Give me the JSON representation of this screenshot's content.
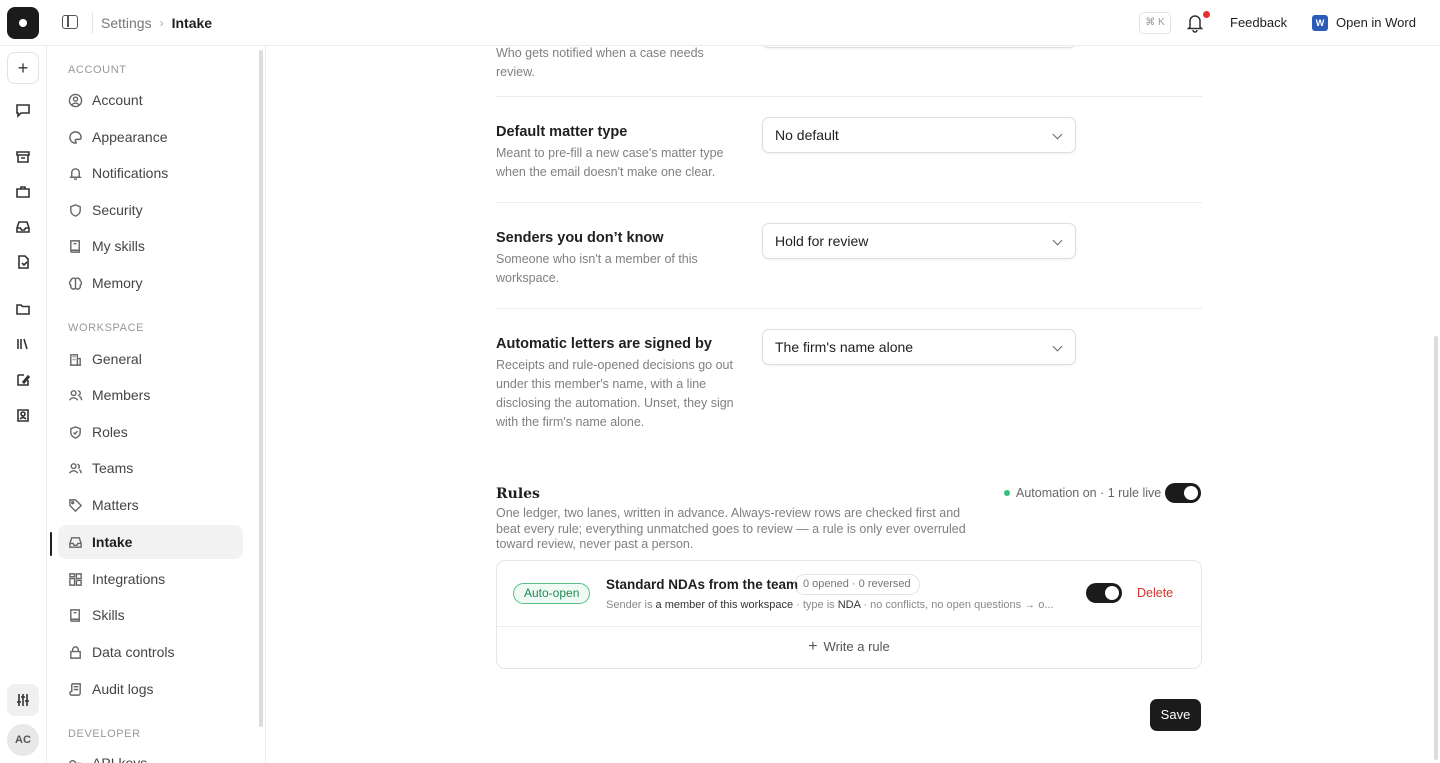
{
  "topbar": {
    "breadcrumb_root": "Settings",
    "breadcrumb_separator": "›",
    "breadcrumb_current": "Intake",
    "shortcut": "⌘ K",
    "feedback": "Feedback",
    "open_in_word": "Open in Word",
    "word_icon_letter": "W",
    "notification_dot_color": "#e5302e"
  },
  "rail": {
    "avatar_initials": "AC",
    "icons": [
      "new-icon",
      "chat-icon",
      "archive-icon",
      "briefcase-icon",
      "inbox-icon",
      "document-icon",
      "folder-icon",
      "library-icon",
      "edit-icon",
      "contact-icon",
      "sliders-icon"
    ]
  },
  "nav": {
    "account_title": "ACCOUNT",
    "account_items": [
      {
        "label": "Account",
        "icon": "user-circle-icon"
      },
      {
        "label": "Appearance",
        "icon": "palette-icon"
      },
      {
        "label": "Notifications",
        "icon": "bell-icon"
      },
      {
        "label": "Security",
        "icon": "shield-icon"
      },
      {
        "label": "My skills",
        "icon": "book-icon"
      },
      {
        "label": "Memory",
        "icon": "brain-icon"
      }
    ],
    "workspace_title": "WORKSPACE",
    "workspace_items": [
      {
        "label": "General",
        "icon": "building-icon"
      },
      {
        "label": "Members",
        "icon": "users-icon"
      },
      {
        "label": "Roles",
        "icon": "shield-check-icon"
      },
      {
        "label": "Teams",
        "icon": "team-icon"
      },
      {
        "label": "Matters",
        "icon": "tag-icon"
      },
      {
        "label": "Intake",
        "icon": "inbox-icon",
        "active": true
      },
      {
        "label": "Integrations",
        "icon": "blocks-icon"
      },
      {
        "label": "Skills",
        "icon": "book-icon"
      },
      {
        "label": "Data controls",
        "icon": "lock-icon"
      },
      {
        "label": "Audit logs",
        "icon": "scroll-icon"
      }
    ],
    "developer_title": "DEVELOPER",
    "developer_items": [
      {
        "label": "API keys",
        "icon": "key-icon"
      }
    ]
  },
  "settings": {
    "partial_desc": "Who gets notified when a case needs review.",
    "default_matter": {
      "label": "Default matter type",
      "desc": "Meant to pre-fill a new case's matter type when the email doesn't make one clear.",
      "value": "No default"
    },
    "unknown_senders": {
      "label": "Senders you don’t know",
      "desc": "Someone who isn't a member of this workspace.",
      "value": "Hold for review"
    },
    "letters_signed": {
      "label": "Automatic letters are signed by",
      "desc": "Receipts and rule-opened decisions go out under this member's name, with a line disclosing the automation. Unset, they sign with the firm's name alone.",
      "value": "The firm's name alone"
    }
  },
  "rules": {
    "title": "Rules",
    "desc": "One ledger, two lanes, written in advance. Always-review rows are checked first and beat every rule; everything unmatched goes to review — a rule is only ever overruled toward review, never past a person.",
    "status": "Automation on · 1 rule live",
    "status_color": "#34c07a",
    "automation_enabled": true,
    "items": [
      {
        "badge": "Auto-open",
        "name": "Standard NDAs from the team",
        "count": "0 opened · 0 reversed",
        "cond_a": "Sender is ",
        "cond_b": "a member of this workspace",
        "cond_c": " · type is ",
        "cond_d": "NDA",
        "cond_e": " · no conflicts, no open questions → o...",
        "enabled": true,
        "delete": "Delete"
      }
    ],
    "write_rule": "Write a rule"
  },
  "save": "Save",
  "colors": {
    "accent": "#1b1b1b",
    "danger": "#d8312c",
    "success": "#34c07a"
  }
}
